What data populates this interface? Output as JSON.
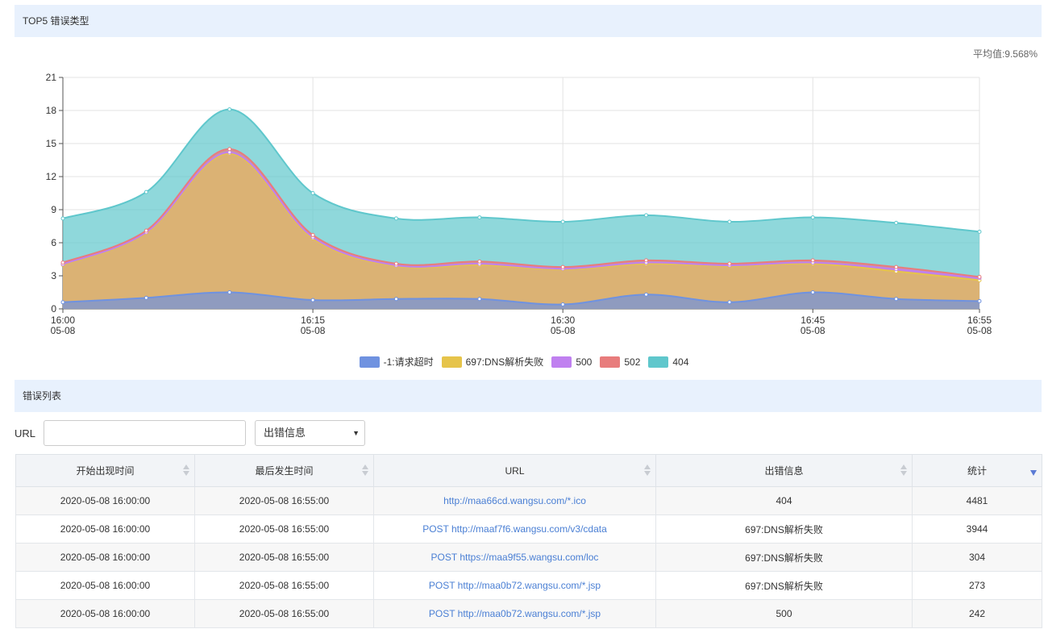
{
  "top_header": {
    "title": "TOP5 错误类型"
  },
  "average": {
    "text": "平均值:9.568%"
  },
  "list_header": {
    "title": "错误列表"
  },
  "filter": {
    "url_label": "URL",
    "url_value": "",
    "select_value": "出错信息"
  },
  "legend": [
    {
      "label": "-1:请求超时",
      "color": "#6f92e0"
    },
    {
      "label": "697:DNS解析失败",
      "color": "#e6c44a"
    },
    {
      "label": "500",
      "color": "#c080f0"
    },
    {
      "label": "502",
      "color": "#e87c7c"
    },
    {
      "label": "404",
      "color": "#5fc7cc"
    }
  ],
  "chart_data": {
    "type": "area",
    "stacked": true,
    "x": [
      "16:00",
      "16:05",
      "16:10",
      "16:15",
      "16:20",
      "16:25",
      "16:30",
      "16:35",
      "16:40",
      "16:45",
      "16:50",
      "16:55"
    ],
    "x_tick_labels": [
      {
        "time": "16:00",
        "date": "05-08"
      },
      {
        "time": "16:15",
        "date": "05-08"
      },
      {
        "time": "16:30",
        "date": "05-08"
      },
      {
        "time": "16:45",
        "date": "05-08"
      },
      {
        "time": "16:55",
        "date": "05-08"
      }
    ],
    "ylim": [
      0,
      21
    ],
    "yticks": [
      0,
      3,
      6,
      9,
      12,
      15,
      18,
      21
    ],
    "grid": true,
    "legend_position": "bottom",
    "series": [
      {
        "name": "-1:请求超时",
        "color": "#6f92e0",
        "values": [
          0.6,
          1.0,
          1.5,
          0.8,
          0.9,
          0.9,
          0.4,
          1.3,
          0.6,
          1.5,
          0.9,
          0.7
        ]
      },
      {
        "name": "697:DNS解析失败",
        "color": "#e6c44a",
        "values": [
          3.4,
          5.9,
          12.6,
          5.6,
          3.0,
          3.1,
          3.2,
          2.8,
          3.3,
          2.6,
          2.5,
          1.9
        ]
      },
      {
        "name": "500",
        "color": "#c080f0",
        "values": [
          0.05,
          0.05,
          0.1,
          0.1,
          0.05,
          0.1,
          0.05,
          0.1,
          0.05,
          0.1,
          0.2,
          0.2
        ]
      },
      {
        "name": "502",
        "color": "#e87c7c",
        "values": [
          0.15,
          0.15,
          0.3,
          0.2,
          0.15,
          0.2,
          0.15,
          0.2,
          0.15,
          0.2,
          0.2,
          0.1
        ]
      },
      {
        "name": "404",
        "color": "#5fc7cc",
        "values": [
          4.0,
          3.5,
          3.6,
          3.8,
          4.1,
          4.0,
          4.1,
          4.1,
          3.8,
          3.9,
          4.0,
          4.1
        ]
      }
    ]
  },
  "table": {
    "columns": [
      "开始出现时间",
      "最后发生时间",
      "URL",
      "出错信息",
      "统计"
    ],
    "rows": [
      [
        "2020-05-08 16:00:00",
        "2020-05-08 16:55:00",
        "http://maa66cd.wangsu.com/*.ico",
        "404",
        "4481"
      ],
      [
        "2020-05-08 16:00:00",
        "2020-05-08 16:55:00",
        "POST http://maaf7f6.wangsu.com/v3/cdata",
        "697:DNS解析失败",
        "3944"
      ],
      [
        "2020-05-08 16:00:00",
        "2020-05-08 16:55:00",
        "POST https://maa9f55.wangsu.com/loc",
        "697:DNS解析失败",
        "304"
      ],
      [
        "2020-05-08 16:00:00",
        "2020-05-08 16:55:00",
        "POST http://maa0b72.wangsu.com/*.jsp",
        "697:DNS解析失败",
        "273"
      ],
      [
        "2020-05-08 16:00:00",
        "2020-05-08 16:55:00",
        "POST http://maa0b72.wangsu.com/*.jsp",
        "500",
        "242"
      ]
    ]
  }
}
